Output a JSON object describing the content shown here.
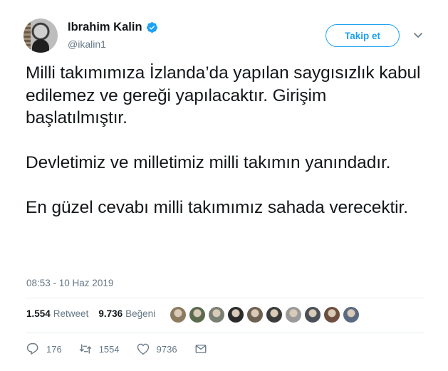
{
  "author": {
    "display_name": "Ibrahim Kalin",
    "handle": "@ikalin1",
    "verified": true
  },
  "follow_button": {
    "label": "Takip et"
  },
  "tweet": {
    "paragraphs": [
      "Milli takımımıza İzlanda’da yapılan saygısızlık kabul edilemez ve gereği yapılacaktır. Girişim başlatılmıştır.",
      "Devletimiz ve milletimiz milli takımın yanındadır.",
      "En güzel cevabı milli takımımız sahada verecektir."
    ],
    "timestamp": "08:53 - 10 Haz 2019"
  },
  "stats": {
    "retweets_count": "1.554",
    "retweets_label": "Retweet",
    "likes_count": "9.736",
    "likes_label": "Beğeni"
  },
  "actions": {
    "reply_count": "176",
    "retweet_count": "1554",
    "like_count": "9736"
  },
  "likers": [
    {
      "color": "#8c7b5e"
    },
    {
      "color": "#5a6b4e"
    },
    {
      "color": "#7a7f74"
    },
    {
      "color": "#2b2b2b"
    },
    {
      "color": "#6d6152"
    },
    {
      "color": "#3b3b3b"
    },
    {
      "color": "#9a9a9a"
    },
    {
      "color": "#4a4f58"
    },
    {
      "color": "#6e4e3e"
    },
    {
      "color": "#5a6a80"
    }
  ],
  "colors": {
    "accent": "#1da1f2",
    "text": "#14171a",
    "muted": "#657786"
  },
  "icons": {
    "verified": "verified-badge-icon",
    "caret": "chevron-down-icon",
    "reply": "reply-icon",
    "retweet": "retweet-icon",
    "like": "heart-icon",
    "dm": "envelope-icon"
  }
}
